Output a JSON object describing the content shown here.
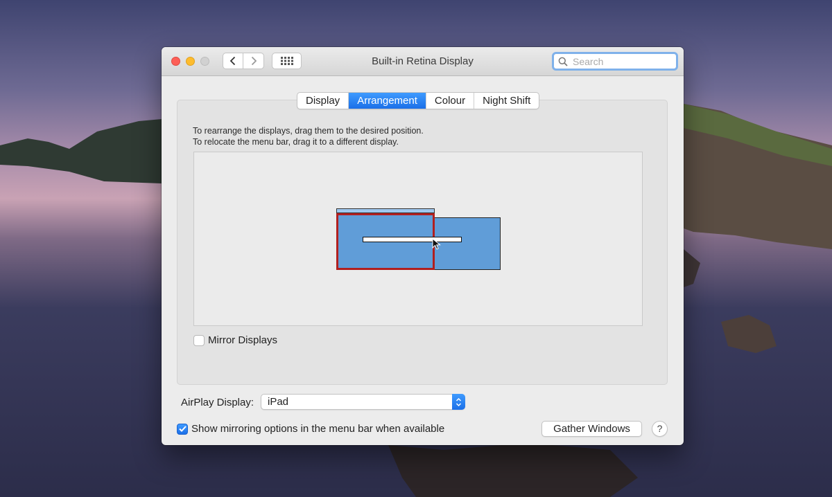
{
  "window": {
    "title": "Built-in Retina Display",
    "search_placeholder": "Search"
  },
  "toolbar": {
    "back_icon": "chevron-left-icon",
    "forward_icon": "chevron-right-icon",
    "grid_icon": "grid-icon"
  },
  "tabs": [
    {
      "label": "Display",
      "active": false
    },
    {
      "label": "Arrangement",
      "active": true
    },
    {
      "label": "Colour",
      "active": false
    },
    {
      "label": "Night Shift",
      "active": false
    }
  ],
  "arrangement": {
    "instruction_1": "To rearrange the displays, drag them to the desired position.",
    "instruction_2": "To relocate the menu bar, drag it to a different display."
  },
  "mirror": {
    "label": "Mirror Displays",
    "checked": false
  },
  "airplay": {
    "label": "AirPlay Display:",
    "value": "iPad"
  },
  "show_options": {
    "label": "Show mirroring options in the menu bar when available",
    "checked": true
  },
  "gather": {
    "label": "Gather Windows"
  },
  "help": {
    "label": "?"
  },
  "colors": {
    "accent": "#1b6fe8",
    "display_fill": "#609dd8",
    "selected_border": "#b11f1f"
  }
}
